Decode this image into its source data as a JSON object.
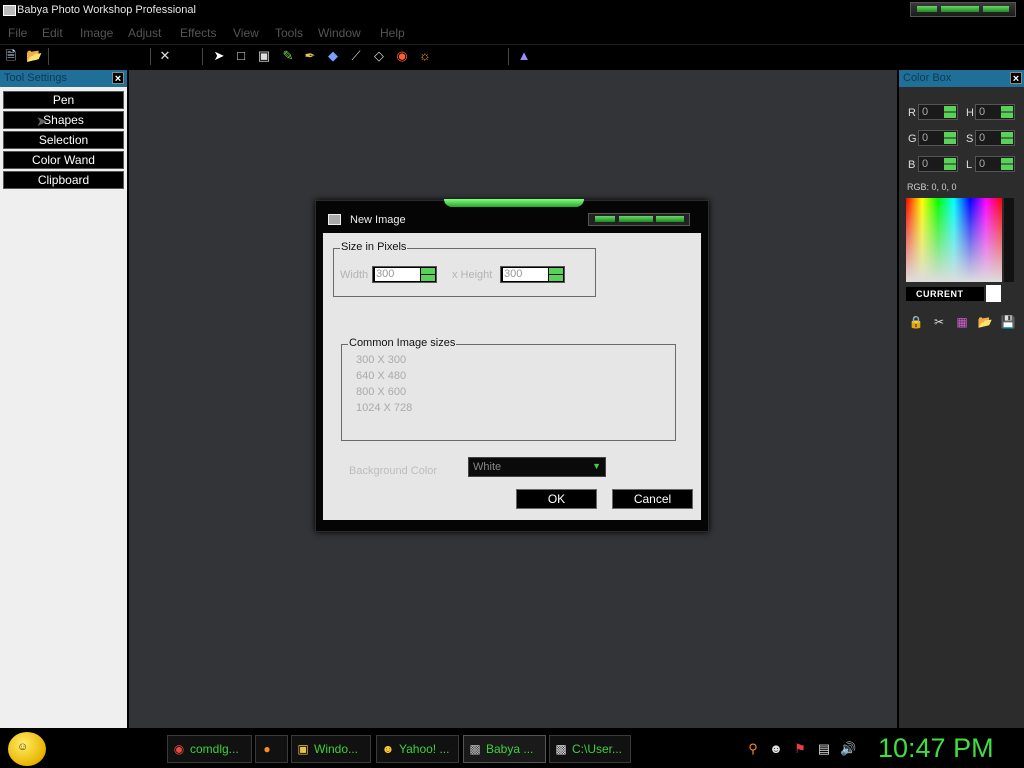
{
  "window": {
    "title": "Babya Photo Workshop Professional"
  },
  "menu": {
    "items": [
      "File",
      "Edit",
      "Image",
      "Adjust",
      "Effects",
      "View",
      "Tools",
      "Window",
      "Help"
    ]
  },
  "toolbar": {
    "icons": [
      "new-file-icon",
      "open-folder-icon",
      "crop-icon",
      "pointer-icon",
      "rectangle-select-icon",
      "lasso-icon",
      "pencil-icon",
      "brush-icon",
      "fill-icon",
      "line-icon",
      "eraser-icon",
      "color-picker-icon",
      "smudge-icon",
      "stamp-icon"
    ]
  },
  "tool_settings": {
    "title": "Tool Settings",
    "buttons": [
      "Pen",
      "Shapes",
      "Selection",
      "Color Wand",
      "Clipboard"
    ]
  },
  "color_box": {
    "title": "Color Box",
    "channels": [
      {
        "label": "R",
        "value": "0"
      },
      {
        "label": "H",
        "value": "0"
      },
      {
        "label": "G",
        "value": "0"
      },
      {
        "label": "S",
        "value": "0"
      },
      {
        "label": "B",
        "value": "0"
      },
      {
        "label": "L",
        "value": "0"
      }
    ],
    "rgb_readout": "RGB: 0, 0, 0",
    "current_label": "CURRENT",
    "current_color": "#ffffff",
    "icons": [
      "lock-icon",
      "cut-icon",
      "palette-icon",
      "folder-open-icon",
      "save-icon"
    ]
  },
  "dialog": {
    "title": "New Image",
    "size_group": {
      "title": "Size in Pixels",
      "width_label": "Width",
      "width_value": "300",
      "height_label": "x  Height",
      "height_value": "300"
    },
    "common_sizes": {
      "title": "Common Image sizes",
      "items": [
        "300 X 300",
        "640 X 480",
        "800 X 600",
        "1024 X 728"
      ]
    },
    "background_label": "Background Color",
    "background_value": "White",
    "ok_label": "OK",
    "cancel_label": "Cancel"
  },
  "taskbar": {
    "tasks": [
      {
        "icon": "chrome-icon",
        "label": "comdlg..."
      },
      {
        "icon": "firefox-icon",
        "label": ""
      },
      {
        "icon": "window-icon",
        "label": "Windo..."
      },
      {
        "icon": "yahoo-icon",
        "label": "Yahoo! ..."
      },
      {
        "icon": "babya-icon",
        "label": "Babya ..."
      },
      {
        "icon": "cmd-icon",
        "label": "C:\\User..."
      }
    ],
    "tray_icons": [
      "search-icon",
      "messenger-icon",
      "flag-icon",
      "network-icon",
      "volume-icon"
    ],
    "clock": "10:47 PM"
  },
  "colors": {
    "accent_green": "#3fdf3f",
    "panel_blue": "#1f6f99",
    "canvas": "#333438"
  }
}
